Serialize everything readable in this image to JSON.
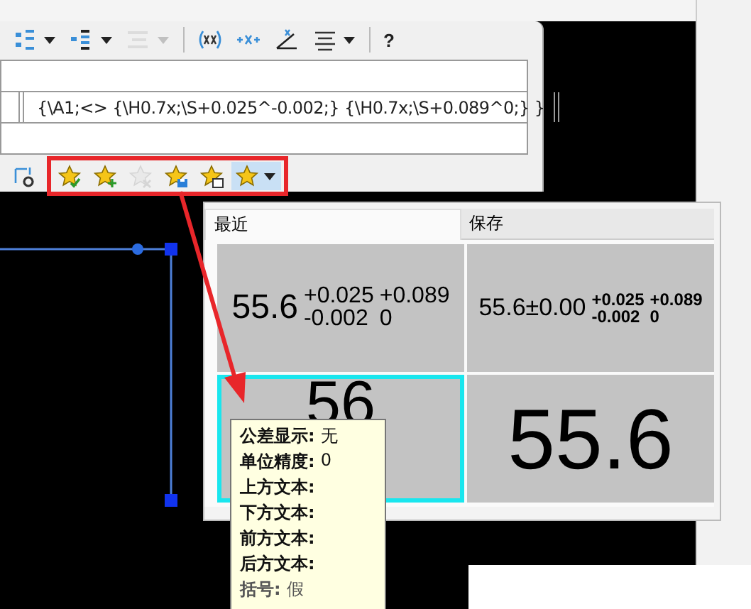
{
  "toolbar": {
    "items": [
      {
        "kind": "stack-precision",
        "dropdown": true,
        "disabled": false
      },
      {
        "kind": "stack-tolerance",
        "dropdown": true,
        "disabled": false
      },
      {
        "kind": "stack-limit",
        "dropdown": true,
        "disabled": true
      },
      {
        "kind": "separator"
      },
      {
        "kind": "brackets",
        "dropdown": false,
        "disabled": false
      },
      {
        "kind": "plus-x",
        "dropdown": false,
        "disabled": false
      },
      {
        "kind": "angle",
        "dropdown": false,
        "disabled": false
      },
      {
        "kind": "align",
        "dropdown": true,
        "disabled": false
      },
      {
        "kind": "separator"
      },
      {
        "kind": "help",
        "text": "?",
        "dropdown": false,
        "disabled": false
      }
    ]
  },
  "editor": {
    "rows": [
      {
        "cells": []
      },
      {
        "cells": [
          "",
          "{\\A1;<> {\\H0.7x;\\S+0.025^-0.002;} {\\H0.7x;\\S+0.089^0;}  }",
          ""
        ]
      },
      {
        "cells": []
      }
    ]
  },
  "favorites_bar": {
    "items": [
      {
        "kind": "settings",
        "disabled": false,
        "selected": false
      },
      {
        "kind": "star-apply",
        "disabled": false,
        "selected": false
      },
      {
        "kind": "star-add",
        "disabled": false,
        "selected": false
      },
      {
        "kind": "star-remove",
        "disabled": true,
        "selected": false
      },
      {
        "kind": "star-save",
        "disabled": false,
        "selected": false
      },
      {
        "kind": "star-copy",
        "disabled": false,
        "selected": false
      },
      {
        "kind": "star-menu",
        "disabled": false,
        "selected": true
      }
    ]
  },
  "preview": {
    "tabs": [
      {
        "label": "最近",
        "selected": true
      },
      {
        "label": "保存",
        "selected": false
      }
    ],
    "cells": [
      {
        "kind": "stacked-large",
        "main": "55.6",
        "upper": [
          "+0.025",
          "+0.089"
        ],
        "lower": [
          "-0.002",
          "0"
        ],
        "selected": false
      },
      {
        "kind": "stacked-small",
        "main": "55.6±0.00",
        "upper": [
          "+0.025",
          "+0.089"
        ],
        "lower": [
          "-0.002",
          "0"
        ],
        "selected": false
      },
      {
        "kind": "plain",
        "main": "56",
        "selected": true
      },
      {
        "kind": "plain",
        "main": "55.6",
        "selected": false
      }
    ]
  },
  "tooltip": {
    "lines": [
      {
        "label": "公差显示:",
        "value": "无",
        "faded": false
      },
      {
        "label": "单位精度:",
        "value": "0",
        "faded": false
      },
      {
        "label": "上方文本:",
        "faded": false
      },
      {
        "label": "下方文本:",
        "faded": false
      },
      {
        "label": "前方文本:",
        "faded": false
      },
      {
        "label": "后方文本:",
        "faded": false
      },
      {
        "label": "括号:",
        "value": "假",
        "faded": true
      }
    ]
  }
}
